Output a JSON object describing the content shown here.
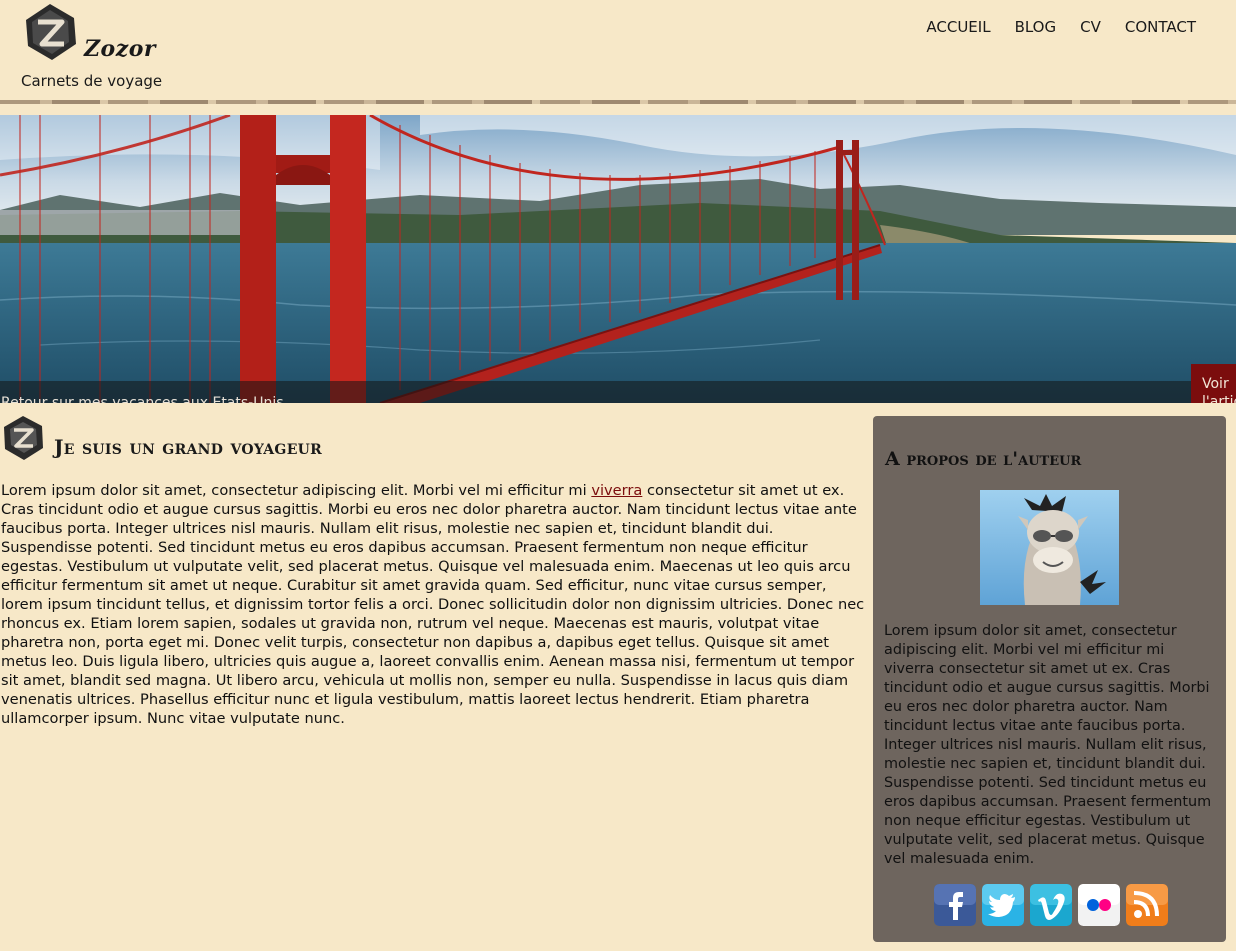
{
  "header": {
    "logo_text": "Zozor",
    "tagline": "Carnets de voyage",
    "nav": [
      "ACCUEIL",
      "BLOG",
      "CV",
      "CONTACT"
    ]
  },
  "banner": {
    "caption": "Retour sur mes vacances aux Etats-Unis",
    "button_label": "Voir l'article"
  },
  "article": {
    "title": "Je suis un grand voyageur",
    "body_before_link": "Lorem ipsum dolor sit amet, consectetur adipiscing elit. Morbi vel mi efficitur mi ",
    "link_text": "viverra",
    "body_after_link": " consectetur sit amet ut ex. Cras tincidunt odio et augue cursus sagittis. Morbi eu eros nec dolor pharetra auctor. Nam tincidunt lectus vitae ante faucibus porta. Integer ultrices nisl mauris. Nullam elit risus, molestie nec sapien et, tincidunt blandit dui. Suspendisse potenti. Sed tincidunt metus eu eros dapibus accumsan. Praesent fermentum non neque efficitur egestas. Vestibulum ut vulputate velit, sed placerat metus. Quisque vel malesuada enim. Maecenas ut leo quis arcu efficitur fermentum sit amet ut neque. Curabitur sit amet gravida quam. Sed efficitur, nunc vitae cursus semper, lorem ipsum tincidunt tellus, et dignissim tortor felis a orci. Donec sollicitudin dolor non dignissim ultricies. Donec nec rhoncus ex. Etiam lorem sapien, sodales ut gravida non, rutrum vel neque. Maecenas est mauris, volutpat vitae pharetra non, porta eget mi. Donec velit turpis, consectetur non dapibus a, dapibus eget tellus. Quisque sit amet metus leo. Duis ligula libero, ultricies quis augue a, laoreet convallis enim. Aenean massa nisi, fermentum ut tempor sit amet, blandit sed magna. Ut libero arcu, vehicula ut mollis non, semper eu nulla. Suspendisse in lacus quis diam venenatis ultrices. Phasellus efficitur nunc et ligula vestibulum, mattis laoreet lectus hendrerit. Etiam pharetra ullamcorper ipsum. Nunc vitae vulputate nunc."
  },
  "sidebar": {
    "title": "A propos de l'auteur",
    "text": "Lorem ipsum dolor sit amet, consectetur adipiscing elit. Morbi vel mi efficitur mi viverra consectetur sit amet ut ex. Cras tincidunt odio et augue cursus sagittis. Morbi eu eros nec dolor pharetra auctor. Nam tincidunt lectus vitae ante faucibus porta. Integer ultrices nisl mauris. Nullam elit risus, molestie nec sapien et, tincidunt blandit dui. Suspendisse potenti. Sed tincidunt metus eu eros dapibus accumsan. Praesent fermentum non neque efficitur egestas. Vestibulum ut vulputate velit, sed placerat metus. Quisque vel malesuada enim.",
    "social_icons": [
      "facebook-icon",
      "twitter-icon",
      "vimeo-icon",
      "flickr-icon",
      "rss-icon"
    ]
  },
  "colors": {
    "page_background": "#f7e8c8",
    "sidebar_background": "#6e655e",
    "accent": "#7b0d0d"
  }
}
